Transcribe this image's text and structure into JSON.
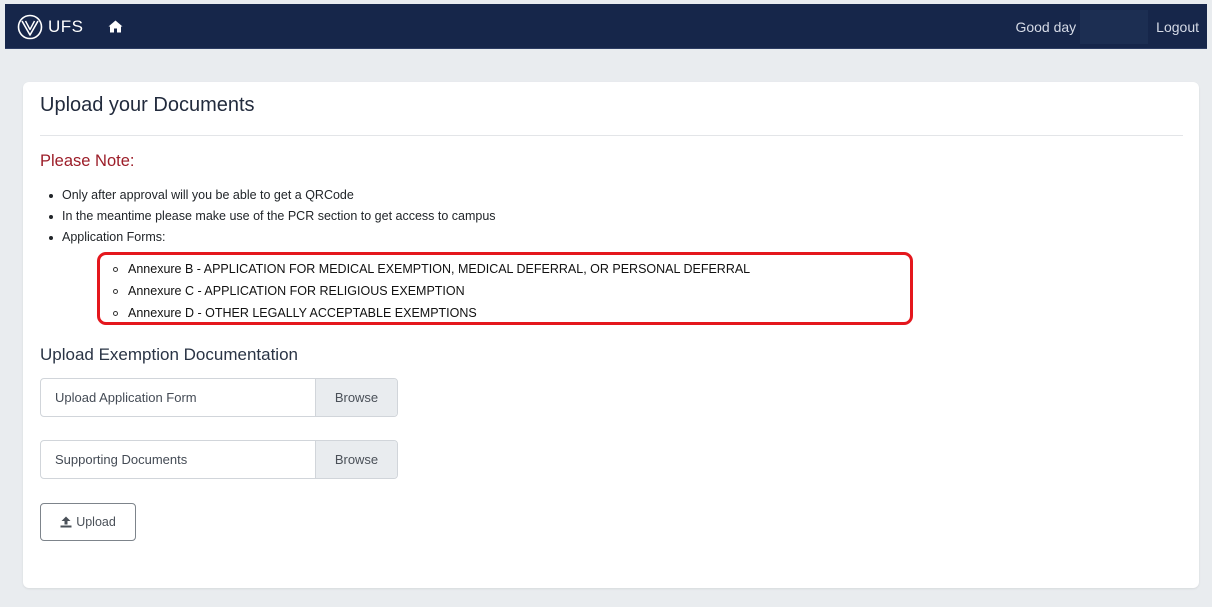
{
  "navbar": {
    "brand": "UFS",
    "greeting": "Good day",
    "logout_label": "Logout",
    "brand_color": "#16264a"
  },
  "card": {
    "title": "Upload your Documents",
    "note_heading": "Please Note:",
    "notes": [
      "Only after approval will you be able to get a QRCode",
      "In the meantime please make use of the PCR section to get access to campus",
      "Application Forms:"
    ],
    "application_forms": [
      "Annexure B - APPLICATION FOR MEDICAL EXEMPTION, MEDICAL DEFERRAL, OR PERSONAL DEFERRAL",
      "Annexure C - APPLICATION FOR RELIGIOUS EXEMPTION",
      "Annexure D - OTHER LEGALLY ACCEPTABLE EXEMPTIONS"
    ],
    "section_heading": "Upload Exemption Documentation",
    "uploads": [
      {
        "label": "Upload Application Form",
        "button": "Browse"
      },
      {
        "label": "Supporting Documents",
        "button": "Browse"
      }
    ],
    "upload_button": "Upload",
    "note_color": "#9c1d28",
    "highlight_color": "#e4171d"
  },
  "icons": {
    "logo": "ufs-shield-icon",
    "home": "home-icon",
    "upload": "upload-icon"
  }
}
